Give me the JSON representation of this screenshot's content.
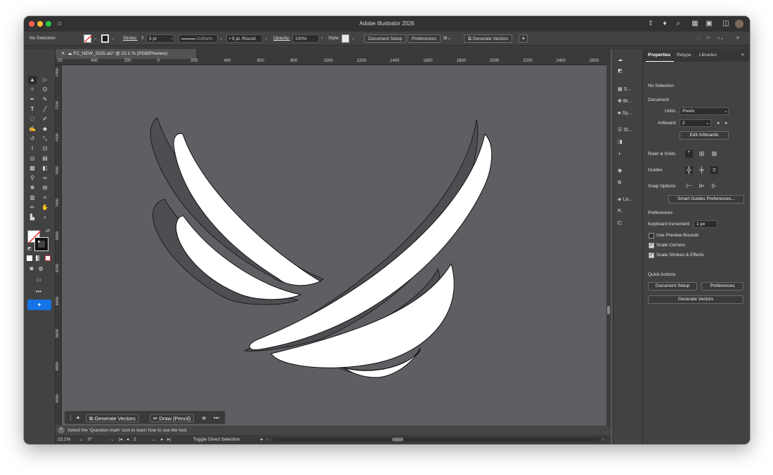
{
  "window": {
    "title": "Adobe Illustrator 2026",
    "traffic": {
      "close": "#ff5f57",
      "min": "#febc2e",
      "max": "#28c840"
    }
  },
  "control_bar": {
    "selection": "No Selection",
    "stroke_label": "Stroke:",
    "stroke_value": "5 pt",
    "profile": "Uniform",
    "brush": "5 pt. Round",
    "opacity_label": "Opacity:",
    "opacity_value": "100%",
    "style_label": "Style:",
    "document_setup": "Document Setup",
    "preferences": "Preferences",
    "generate_vectors": "Generate Vectors"
  },
  "document_tab": {
    "name": "FC_NEW_2025.aic* @ 22.1 % (RGB/Preview)"
  },
  "rulers": {
    "top": [
      "00",
      "400",
      "200",
      "0",
      "200",
      "400",
      "600",
      "800",
      "1000",
      "1200",
      "1400",
      "1600",
      "1800",
      "2000",
      "2200",
      "2400",
      "2600"
    ],
    "left": [
      "7000",
      "7200",
      "7400",
      "7600",
      "7800",
      "8000",
      "8200",
      "8400",
      "8600",
      "8800",
      "9000"
    ]
  },
  "context_bar": {
    "generate_vectors": "Generate Vectors",
    "draw_pencil": "Draw (Pencil)"
  },
  "hint": "Select the 'Question mark' icon to learn how to use the tool.",
  "status_bar": {
    "zoom": "22.1%",
    "rotation": "0°",
    "artboard": "2",
    "tool": "Toggle Direct Selection"
  },
  "icon_panels": [
    "S...",
    "Br...",
    "Sy...",
    "St...",
    "La..."
  ],
  "properties": {
    "tabs": [
      "Properties",
      "Retype",
      "Libraries"
    ],
    "selection": "No Selection",
    "document_header": "Document",
    "units_label": "Units:",
    "units_value": "Pixels",
    "artboard_label": "Artboard:",
    "artboard_value": "2",
    "edit_artboards": "Edit Artboards",
    "ruler_grids": "Ruler & Grids",
    "guides": "Guides",
    "snap_options": "Snap Options",
    "smart_guides_prefs": "Smart Guides Preferences...",
    "preferences_header": "Preferences",
    "keyboard_increment_label": "Keyboard Increment:",
    "keyboard_increment_value": "1 px",
    "use_preview_bounds": "Use Preview Bounds",
    "use_preview_bounds_checked": false,
    "scale_corners": "Scale Corners",
    "scale_corners_checked": true,
    "scale_strokes": "Scale Strokes & Effects",
    "scale_strokes_checked": true,
    "quick_actions": "Quick Actions",
    "qa_document_setup": "Document Setup",
    "qa_preferences": "Preferences",
    "qa_generate_vectors": "Generate Vectors"
  },
  "colors": {
    "canvas": "#5f5e63",
    "accent": "#1473e6",
    "shape_fill": "#ffffff",
    "shadow_fill": "#4e4d52"
  }
}
